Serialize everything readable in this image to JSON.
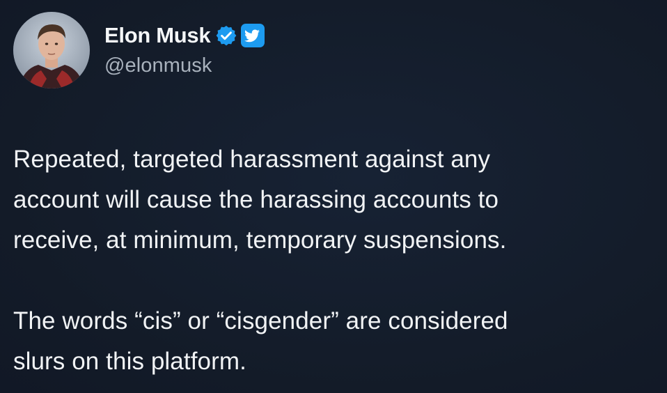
{
  "tweet": {
    "author": {
      "display_name": "Elon Musk",
      "handle": "@elonmusk",
      "avatar_icon": "profile-photo",
      "verified_icon": "verified-badge-icon",
      "platform_icon": "twitter-bird-icon"
    },
    "paragraphs": [
      "Repeated, targeted harassment against any\naccount will cause the harassing accounts to\nreceive, at minimum, temporary suspensions.",
      "The words “cis” or “cisgender” are considered\nslurs on this platform."
    ]
  },
  "colors": {
    "background": "#141d2b",
    "text": "#f1f3f5",
    "handle": "#a9b2bd",
    "verified": "#1d9bf0",
    "twitter_blue": "#1d9bf0"
  }
}
